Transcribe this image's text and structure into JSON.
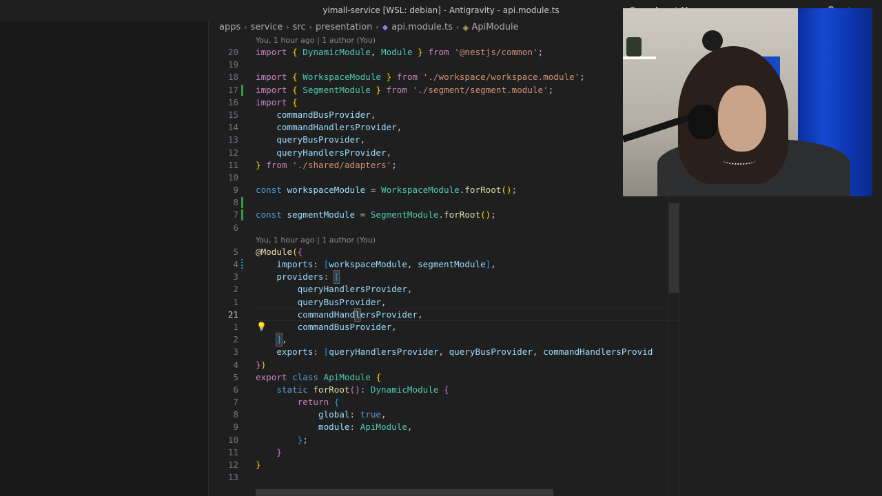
{
  "window": {
    "title": "yimall-service [WSL: debian] - Antigravity - api.module.ts",
    "agent_manager": "Open Agent Manager"
  },
  "breadcrumb": {
    "items": [
      "apps",
      "service",
      "src",
      "presentation"
    ],
    "file": "api.module.ts",
    "symbol": "ApiModule"
  },
  "codelens": {
    "top": "You, 1 hour ago | 1 author (You)",
    "module": "You, 1 hour ago | 1 author (You)"
  },
  "lines": {
    "l20": "20",
    "l19": "19",
    "l18": "18",
    "l17": "17",
    "l16": "16",
    "l15": "15",
    "l14": "14",
    "l13": "13",
    "l12": "12",
    "l11": "11",
    "l10": "10",
    "l9": "9",
    "l8": "8",
    "l7": "7",
    "l6": "6",
    "l5": "5",
    "l4": "4",
    "l3": "3",
    "l2": "2",
    "l1": "1",
    "l21": "21",
    "n1": "1",
    "n2": "2",
    "n3": "3",
    "n4": "4",
    "n5": "5",
    "n6": "6",
    "n7": "7",
    "n8": "8",
    "n9": "9",
    "n10": "10",
    "n11": "11",
    "n12": "12",
    "n13": "13"
  },
  "colors": {
    "keyword": "#c586c0",
    "class": "#4ec9b0",
    "variable": "#9cdcfe",
    "function": "#dcdcaa",
    "string": "#ce9178",
    "added_gutter": "#2ea043"
  }
}
